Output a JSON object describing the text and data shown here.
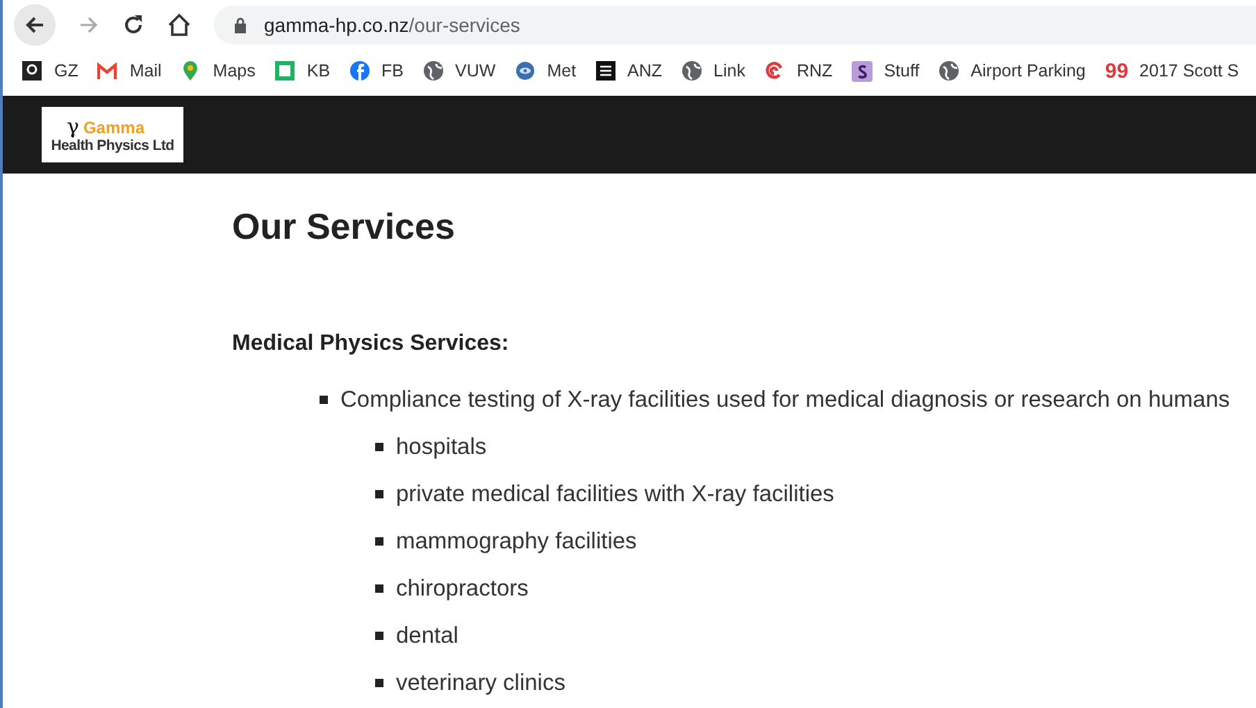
{
  "browser": {
    "url_host": "gamma-hp.co.nz",
    "url_path": "/our-services",
    "bookmarks": [
      {
        "kind": "letter-tile",
        "label": "GZ"
      },
      {
        "kind": "mail",
        "label": "Mail"
      },
      {
        "kind": "pin",
        "label": "Maps"
      },
      {
        "kind": "square",
        "label": "KB"
      },
      {
        "kind": "facebook",
        "label": "FB"
      },
      {
        "kind": "globe",
        "label": "VUW"
      },
      {
        "kind": "eye",
        "label": "Met"
      },
      {
        "kind": "dark-tile",
        "label": "ANZ"
      },
      {
        "kind": "globe",
        "label": "Link"
      },
      {
        "kind": "swirl",
        "label": "RNZ"
      },
      {
        "kind": "purple-tile",
        "label": "Stuff"
      },
      {
        "kind": "globe",
        "label": "Airport Parking"
      },
      {
        "kind": "quote",
        "icon_text": "99",
        "label": "2017 Scott S"
      }
    ]
  },
  "header": {
    "logo": {
      "symbol": "γ",
      "name": "Gamma",
      "tagline": "Health Physics Ltd"
    }
  },
  "page": {
    "title": "Our Services",
    "section": "Medical Physics Services:",
    "items": [
      {
        "text": "Compliance testing of X-ray facilities used for medical diagnosis or research on humans",
        "children": [
          {
            "text": "hospitals"
          },
          {
            "text": "private medical facilities with X-ray facilities"
          },
          {
            "text": "mammography facilities"
          },
          {
            "text": "chiropractors"
          },
          {
            "text": "dental"
          },
          {
            "text": "veterinary clinics"
          }
        ]
      }
    ]
  }
}
